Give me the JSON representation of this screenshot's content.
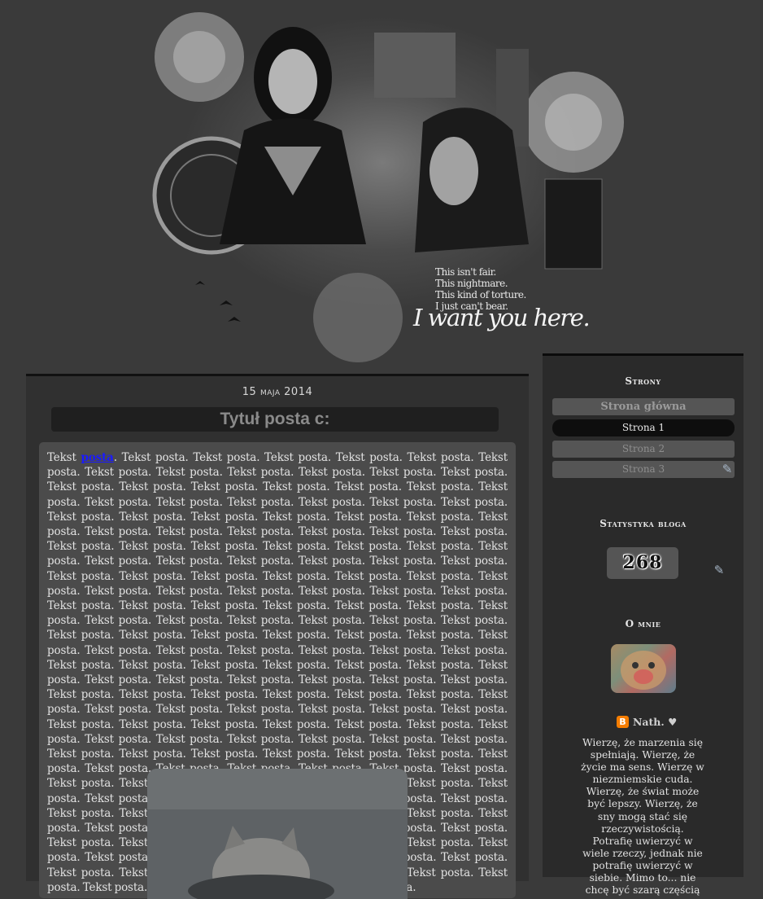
{
  "header": {
    "quote_lines": [
      "This isn't fair.",
      "This nightmare.",
      "This kind of torture.",
      "I just can't bear."
    ],
    "big_line": "I want you here."
  },
  "post": {
    "date": "15 maja 2014",
    "title": "Tytuł posta c:",
    "body_start": "Tekst ",
    "body_link": "posta",
    "body_rest": ". Tekst posta. Tekst posta. Tekst posta. Tekst posta. Tekst posta. Tekst posta. Tekst posta. Tekst posta. Tekst posta. Tekst posta. Tekst posta. Tekst posta. Tekst posta. Tekst posta. Tekst posta. Tekst posta. Tekst posta. Tekst posta. Tekst posta. Tekst posta. Tekst posta. Tekst posta. Tekst posta. Tekst posta. Tekst posta. Tekst posta. Tekst posta. Tekst posta. Tekst posta. Tekst posta. Tekst posta. Tekst posta. Tekst posta. Tekst posta. Tekst posta. Tekst posta. Tekst posta. Tekst posta. Tekst posta. Tekst posta. Tekst posta. Tekst posta. Tekst posta. Tekst posta. Tekst posta. Tekst posta. Tekst posta. Tekst posta. Tekst posta. Tekst posta. Tekst posta. Tekst posta. Tekst posta. Tekst posta. Tekst posta. Tekst posta. Tekst posta. Tekst posta. Tekst posta. Tekst posta. Tekst posta. Tekst posta. Tekst posta. Tekst posta. Tekst posta. Tekst posta. Tekst posta. Tekst posta. Tekst posta. Tekst posta. Tekst posta. Tekst posta. Tekst posta. Tekst posta. Tekst posta. Tekst posta. Tekst posta. Tekst posta. Tekst posta. Tekst posta. Tekst posta. Tekst posta. Tekst posta. Tekst posta. Tekst posta. Tekst posta. Tekst posta. Tekst posta. Tekst posta. Tekst posta. Tekst posta. Tekst posta. Tekst posta. Tekst posta. Tekst posta. Tekst posta. Tekst posta. Tekst posta. Tekst posta. Tekst posta. Tekst posta. Tekst posta. Tekst posta. Tekst posta. Tekst posta. Tekst posta. Tekst posta. Tekst posta. Tekst posta. Tekst posta. Tekst posta. Tekst posta. Tekst posta. Tekst posta. Tekst posta. Tekst posta. Tekst posta. Tekst posta. Tekst posta. Tekst posta. Tekst posta. Tekst posta. Tekst posta. Tekst posta. Tekst posta. Tekst posta. Tekst posta. Tekst posta. Tekst posta. Tekst posta. Tekst posta. Tekst posta. Tekst posta. Tekst posta. Tekst posta. Tekst posta. Tekst posta. Tekst posta. Tekst posta. Tekst posta. Tekst posta. Tekst posta. Tekst posta. Tekst posta. Tekst posta. Tekst posta. Tekst posta. Tekst posta. Tekst posta. Tekst posta. Tekst posta. Tekst posta. Tekst posta. Tekst posta. Tekst posta. Tekst posta. Tekst posta. Tekst posta. Tekst posta. Tekst posta. Tekst posta. Tekst posta. Tekst posta. Tekst posta. Tekst posta. Tekst posta. Tekst posta. Tekst posta. Tekst posta. Tekst posta. Tekst posta. Tekst posta. Tekst posta. Tekst posta. Tekst posta. Tekst posta. Tekst posta. Tekst posta. Tekst posta. Tekst posta. Tekst posta. Tekst posta. Tekst posta. Tekst posta. Tekst posta. Tekst posta. Tekst posta. Tekst posta. Tekst posta. Tekst posta. Tekst posta. Tekst posta. Tekst posta."
  },
  "sidebar": {
    "pages_heading": "Strony",
    "pages": [
      {
        "label": "Strona główna"
      },
      {
        "label": "Strona 1"
      },
      {
        "label": "Strona 2"
      },
      {
        "label": "Strona 3"
      }
    ],
    "stats_heading": "Statystyka bloga",
    "counter_value": "268",
    "about_heading": "O mnie",
    "profile_name": "Nath. ♥",
    "about_text": "Wierzę, że marzenia się spełniają. Wierzę, że życie ma sens. Wierzę w niezmiemskie cuda. Wierzę, że świat może być lepszy. Wierzę, że sny mogą stać się rzeczywistością. Potrafię uwierzyć w wiele rzeczy, jednak nie potrafię uwierzyć w siebie. Mimo to... nie chcę być szarą częścią"
  },
  "icons": {
    "edit": "wrench-screwdriver-icon",
    "blogger": "blogger-icon"
  },
  "colors": {
    "background": "#3a3a3a",
    "link": "#1a1aff",
    "blogger_orange": "#f57d00"
  }
}
